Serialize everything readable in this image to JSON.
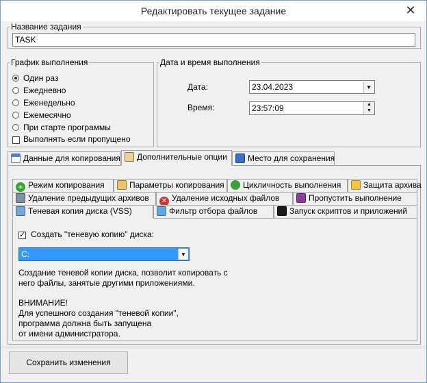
{
  "window": {
    "title": "Редактировать текущее задание",
    "close_glyph": "✕"
  },
  "task_name": {
    "label": "Название задания",
    "value": "TASK"
  },
  "schedule": {
    "label": "График выполнения",
    "options": [
      {
        "label": "Один раз",
        "selected": true
      },
      {
        "label": "Ежедневно",
        "selected": false
      },
      {
        "label": "Еженедельно",
        "selected": false
      },
      {
        "label": "Ежемесячно",
        "selected": false
      },
      {
        "label": "При старте программы",
        "selected": false
      }
    ],
    "run_if_missed": {
      "label": "Выполнять если пропущено",
      "checked": false
    }
  },
  "datetime": {
    "label": "Дата и время выполнения",
    "date_label": "Дата:",
    "date_value": "23.04.2023",
    "time_label": "Время:",
    "time_value": "23:57:09"
  },
  "main_tabs": [
    {
      "label": "Данные для копирования",
      "icon": "table-icon",
      "active": false
    },
    {
      "label": "Дополнительные опции",
      "icon": "options-icon",
      "active": true
    },
    {
      "label": "Место для сохранения",
      "icon": "disk-icon",
      "active": false
    }
  ],
  "sub_tabs": {
    "row1": [
      {
        "label": "Режим копирования",
        "icon": "plus-icon"
      },
      {
        "label": "Параметры копирования",
        "icon": "params-icon"
      },
      {
        "label": "Цикличность выполнения",
        "icon": "cycle-icon"
      },
      {
        "label": "Защита архива",
        "icon": "lock-icon"
      }
    ],
    "row2": [
      {
        "label": "Удаление предыдущих архивов",
        "icon": "archive-icon"
      },
      {
        "label": "Удаление исходных файлов",
        "icon": "delete-icon"
      },
      {
        "label": "Пропустить выполнение",
        "icon": "skip-icon"
      }
    ],
    "row3": [
      {
        "label": "Теневая копия диска (VSS)",
        "icon": "vss-icon",
        "active": true
      },
      {
        "label": "Фильтр отбора файлов",
        "icon": "filter-icon"
      },
      {
        "label": "Запуск скриптов и приложений",
        "icon": "script-icon"
      }
    ]
  },
  "vss": {
    "create_label": "Создать \"теневую копию\" диска:",
    "create_checked": true,
    "drive_value": "C:",
    "description_line1": "Создание теневой копии диска, позволит копировать с",
    "description_line2": "него файлы, занятые другими приложениями.",
    "warning_title": "ВНИМАНИЕ!",
    "warning_line1": "Для успешного создания \"теневой копии\",",
    "warning_line2": "программа должна быть запущена",
    "warning_line3": "от имени администратора."
  },
  "save_button": {
    "label": "Сохранить изменения"
  },
  "colors": {
    "accent": "#3399ff",
    "border": "#a0a0a0",
    "window_border": "#7a9cc6"
  }
}
